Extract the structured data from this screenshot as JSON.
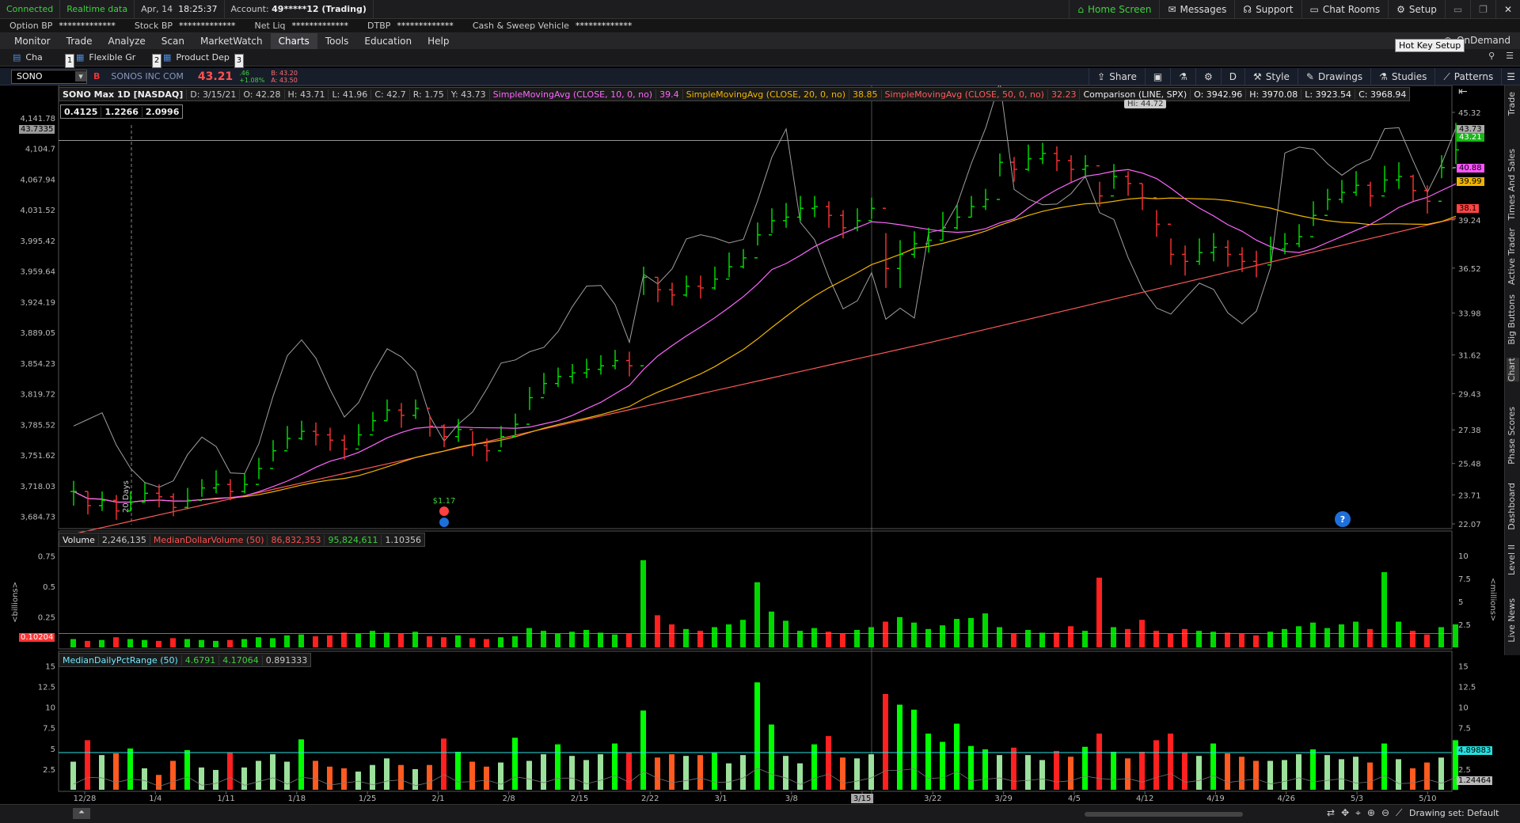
{
  "status": {
    "connected": "Connected",
    "realtime": "Realtime data",
    "date": "Apr, 14",
    "time": "18:25:37",
    "account_label": "Account:",
    "account_value": "49*****12 (Trading)",
    "home": "Home Screen",
    "messages": "Messages",
    "support": "Support",
    "chat_rooms": "Chat Rooms",
    "setup": "Setup"
  },
  "account_bar": [
    {
      "label": "Option BP",
      "value": "*************"
    },
    {
      "label": "Stock BP",
      "value": "*************"
    },
    {
      "label": "Net Liq",
      "value": "*************"
    },
    {
      "label": "DTBP",
      "value": "*************"
    },
    {
      "label": "Cash & Sweep Vehicle",
      "value": "*************"
    }
  ],
  "menu": [
    "Monitor",
    "Trade",
    "Analyze",
    "Scan",
    "MarketWatch",
    "Charts",
    "Tools",
    "Education",
    "Help"
  ],
  "menu_active": "Charts",
  "ondemand": "OnDemand",
  "hotkey_tooltip": "Hot Key Setup",
  "tabs": [
    {
      "label": "Cha",
      "num": "1"
    },
    {
      "label": "Flexible Gr",
      "num": "2"
    },
    {
      "label": "Product Dep",
      "num": "3"
    }
  ],
  "symbol_bar": {
    "symbol": "SONO",
    "company": "SONOS INC COM",
    "last": "43.21",
    "change": ".46",
    "change_pct": "+1.08%",
    "bid": "B: 43.20",
    "ask": "A: 43.50"
  },
  "chart_tools": [
    "Share",
    "D",
    "Style",
    "Drawings",
    "Studies",
    "Patterns"
  ],
  "price_header": {
    "title": "SONO Max 1D [NASDAQ]",
    "date": "D: 3/15/21",
    "open": "O: 42.28",
    "high": "H: 43.71",
    "low": "L: 41.96",
    "close": "C: 42.7",
    "range": "R: 1.75",
    "y": "Y: 43.73",
    "sma10_label": "SimpleMovingAvg (CLOSE, 10, 0, no)",
    "sma10_value": "39.4",
    "sma20_label": "SimpleMovingAvg (CLOSE, 20, 0, no)",
    "sma20_value": "38.85",
    "sma50_label": "SimpleMovingAvg (CLOSE, 50, 0, no)",
    "sma50_value": "32.23",
    "comparison_label": "Comparison (LINE, SPX)",
    "comp_open": "O: 3942.96",
    "comp_high": "H: 3970.08",
    "comp_low": "L: 3923.54",
    "comp_close": "C: 3968.94"
  },
  "value_box": [
    "0.4125",
    "1.2266",
    "2.0996"
  ],
  "cursor_label_left": "43.7335",
  "hi_label": "Hi: 44.72",
  "dividend_label": "$1.17",
  "vertical_annotation": "20 Days",
  "volume_header": {
    "title": "Volume",
    "value": "2,246,135",
    "mdv_label": "MedianDollarVolume (50)",
    "mdv_v1": "86,832,353",
    "mdv_v2": "95,824,611",
    "mdv_v3": "1.10356"
  },
  "volume_left_value": "0.10204",
  "volume_left_unit": "<billions>",
  "volume_right_unit": "<millions>",
  "mdpr_header": {
    "title": "MedianDailyPctRange (50)",
    "v1": "4.6791",
    "v2": "4.17064",
    "v3": "0.891333"
  },
  "mdpr_right_values": [
    "4.89883",
    "1.24464"
  ],
  "price_badges": [
    "43.73",
    "43.21",
    "40.88",
    "39.99",
    "38.1"
  ],
  "right_tabs": [
    "Trade",
    "Times And Sales",
    "Active Trader",
    "Big Buttons",
    "Chart",
    "Phase Scores",
    "Dashboard",
    "Level II",
    "Live News"
  ],
  "drawing_set": "Drawing set: Default",
  "colors": {
    "up": "#00e600",
    "down": "#ff3333",
    "sma10": "#ff66ff",
    "sma20": "#f0b400",
    "sma50": "#ff5a5a",
    "comparison": "#a0a0a0"
  },
  "chart_data": [
    {
      "type": "bar",
      "subtype": "ohlc",
      "x_ticks": [
        "12/28",
        "1/4",
        "1/11",
        "1/18",
        "1/25",
        "2/1",
        "2/8",
        "2/15",
        "2/22",
        "3/1",
        "3/8",
        "3/15",
        "3/22",
        "3/29",
        "4/5",
        "4/12",
        "4/19",
        "4/26",
        "5/3",
        "5/10"
      ],
      "y_ticks_right": [
        "45.32",
        "42.17",
        "39.24",
        "36.52",
        "33.98",
        "31.62",
        "29.43",
        "27.38",
        "25.48",
        "23.71",
        "22.07"
      ],
      "y_ticks_left": [
        "4,141.78",
        "4,104.7",
        "4,067.94",
        "4,031.52",
        "3,995.42",
        "3,959.64",
        "3,924.19",
        "3,889.05",
        "3,854.23",
        "3,819.72",
        "3,785.52",
        "3,751.62",
        "3,718.03",
        "3,684.73"
      ],
      "ylim": [
        22.07,
        45.32
      ],
      "close": [
        23.9,
        23.1,
        23.4,
        22.8,
        23.3,
        23.8,
        23.6,
        23.0,
        23.4,
        24.1,
        24.3,
        23.9,
        24.3,
        25.2,
        26.2,
        26.9,
        27.3,
        27.1,
        26.8,
        26.3,
        27.1,
        27.9,
        28.5,
        28.2,
        28.6,
        27.6,
        27.0,
        27.4,
        26.5,
        26.2,
        27.0,
        27.7,
        29.2,
        30.0,
        30.4,
        30.6,
        30.8,
        31.0,
        31.3,
        31.0,
        36.0,
        35.3,
        35.0,
        35.5,
        35.4,
        35.9,
        36.6,
        37.1,
        38.4,
        39.2,
        39.4,
        39.9,
        40.0,
        39.5,
        38.8,
        39.2,
        39.9,
        36.5,
        37.3,
        37.9,
        38.1,
        38.8,
        39.4,
        40.0,
        40.4,
        42.5,
        42.1,
        42.7,
        43.0,
        42.6,
        42.1,
        42.3,
        40.6,
        41.7,
        41.3,
        40.5,
        39.0,
        37.3,
        36.9,
        37.4,
        37.7,
        37.3,
        36.9,
        36.7,
        37.6,
        37.9,
        38.3,
        39.5,
        40.4,
        40.8,
        41.2,
        40.6,
        41.5,
        41.7,
        40.9,
        40.3,
        42.2,
        43.2
      ],
      "high": [
        24.5,
        23.9,
        23.9,
        23.7,
        23.9,
        24.4,
        24.3,
        23.8,
        24.1,
        24.6,
        25.1,
        24.6,
        24.9,
        25.8,
        26.8,
        27.6,
        27.9,
        27.8,
        27.5,
        27.1,
        27.7,
        28.4,
        29.1,
        28.9,
        29.1,
        28.2,
        27.7,
        28.0,
        27.3,
        26.9,
        27.6,
        28.3,
        29.8,
        30.6,
        30.9,
        31.1,
        31.4,
        31.6,
        31.9,
        31.8,
        36.6,
        36.0,
        35.7,
        36.1,
        36.1,
        36.6,
        37.4,
        37.6,
        39.1,
        39.9,
        40.2,
        40.6,
        40.6,
        40.3,
        39.8,
        39.9,
        40.5,
        38.5,
        38.1,
        38.6,
        38.8,
        39.7,
        40.1,
        40.6,
        41.0,
        43.0,
        42.8,
        43.5,
        43.6,
        43.4,
        42.9,
        42.9,
        41.4,
        42.4,
        42.0,
        41.3,
        39.8,
        38.2,
        37.8,
        38.2,
        38.5,
        38.1,
        37.7,
        37.5,
        38.3,
        38.5,
        39.0,
        40.3,
        41.0,
        41.5,
        42.0,
        41.4,
        42.3,
        42.5,
        41.8,
        41.2,
        42.9,
        44.72
      ],
      "low": [
        23.1,
        22.6,
        22.8,
        22.3,
        22.8,
        23.3,
        23.0,
        22.5,
        22.9,
        23.6,
        23.8,
        23.4,
        23.8,
        24.6,
        25.6,
        26.3,
        26.8,
        26.5,
        26.2,
        25.7,
        26.5,
        27.3,
        27.9,
        27.5,
        28.0,
        27.0,
        26.4,
        26.7,
        25.9,
        25.6,
        26.4,
        27.1,
        28.5,
        29.4,
        29.8,
        30.0,
        30.3,
        30.5,
        30.8,
        30.4,
        35.0,
        34.6,
        34.4,
        34.9,
        34.8,
        35.3,
        36.0,
        36.5,
        37.8,
        38.5,
        38.8,
        39.2,
        39.4,
        38.8,
        38.2,
        38.6,
        39.3,
        35.4,
        35.4,
        37.1,
        37.4,
        38.1,
        38.7,
        39.4,
        39.8,
        41.7,
        41.4,
        42.0,
        42.4,
        42.0,
        41.4,
        41.6,
        40.0,
        41.0,
        40.6,
        39.8,
        38.3,
        36.7,
        36.1,
        36.7,
        36.9,
        36.6,
        36.3,
        36.0,
        36.9,
        37.3,
        37.7,
        38.9,
        39.8,
        40.2,
        40.6,
        40.0,
        40.8,
        41.0,
        40.3,
        39.6,
        41.6,
        42.4
      ]
    },
    {
      "type": "bar",
      "name": "Volume",
      "y_ticks_left": [
        "0.75",
        "0.5",
        "0.25"
      ],
      "y_ticks_right": [
        "10",
        "7.5",
        "5",
        "2.5"
      ],
      "values_millions": [
        0.9,
        0.7,
        0.8,
        1.1,
        0.9,
        0.8,
        0.7,
        1.0,
        0.9,
        0.8,
        0.7,
        0.8,
        0.9,
        1.1,
        1.0,
        1.3,
        1.4,
        1.2,
        1.3,
        1.6,
        1.5,
        1.8,
        1.6,
        1.5,
        1.7,
        1.2,
        1.1,
        1.3,
        1.0,
        0.9,
        1.1,
        1.2,
        2.1,
        1.8,
        1.5,
        1.7,
        1.9,
        1.6,
        1.4,
        1.5,
        9.5,
        3.5,
        2.5,
        2.0,
        1.8,
        2.2,
        2.5,
        3.0,
        7.1,
        3.9,
        2.9,
        1.8,
        2.1,
        1.7,
        1.5,
        1.9,
        2.2,
        2.8,
        3.3,
        2.7,
        2.0,
        2.4,
        3.1,
        3.2,
        3.7,
        2.2,
        1.5,
        1.9,
        1.6,
        1.6,
        2.3,
        1.8,
        7.6,
        2.2,
        2.0,
        3.0,
        1.8,
        1.5,
        2.0,
        1.8,
        1.7,
        1.6,
        1.5,
        1.3,
        1.7,
        2.0,
        2.3,
        2.7,
        2.1,
        2.5,
        2.8,
        2.0,
        8.2,
        2.8,
        1.8,
        1.4,
        2.2,
        2.5
      ],
      "median_millions": 1.5
    },
    {
      "type": "bar",
      "name": "MedianDailyPctRange (50)",
      "y_ticks": [
        "15",
        "12.5",
        "10",
        "7.5",
        "5",
        "2.5"
      ],
      "values": [
        3.4,
        6.0,
        4.2,
        4.4,
        5.0,
        2.6,
        1.8,
        3.5,
        4.8,
        2.7,
        2.4,
        4.5,
        2.7,
        3.5,
        4.3,
        3.4,
        6.1,
        3.5,
        2.8,
        2.6,
        2.2,
        3.0,
        3.8,
        3.0,
        2.5,
        3.0,
        6.2,
        4.6,
        3.4,
        2.8,
        3.3,
        6.3,
        3.5,
        4.3,
        5.5,
        4.1,
        3.6,
        4.3,
        5.6,
        4.5,
        9.6,
        3.9,
        4.3,
        4.1,
        4.2,
        4.5,
        3.2,
        4.2,
        13.0,
        7.9,
        4.1,
        3.2,
        5.5,
        6.5,
        3.9,
        3.8,
        4.3,
        11.6,
        10.3,
        9.7,
        6.8,
        5.8,
        8.0,
        5.3,
        4.9,
        4.2,
        5.1,
        4.2,
        3.6,
        4.7,
        4.0,
        5.2,
        6.8,
        4.6,
        3.8,
        4.6,
        6.0,
        6.8,
        4.5,
        4.1,
        5.6,
        4.4,
        4.0,
        3.5,
        3.5,
        3.6,
        4.3,
        4.9,
        4.2,
        3.7,
        4.0,
        3.3,
        5.6,
        3.7,
        2.6,
        3.3,
        3.9,
        6.0
      ],
      "median_line": 4.5
    }
  ]
}
